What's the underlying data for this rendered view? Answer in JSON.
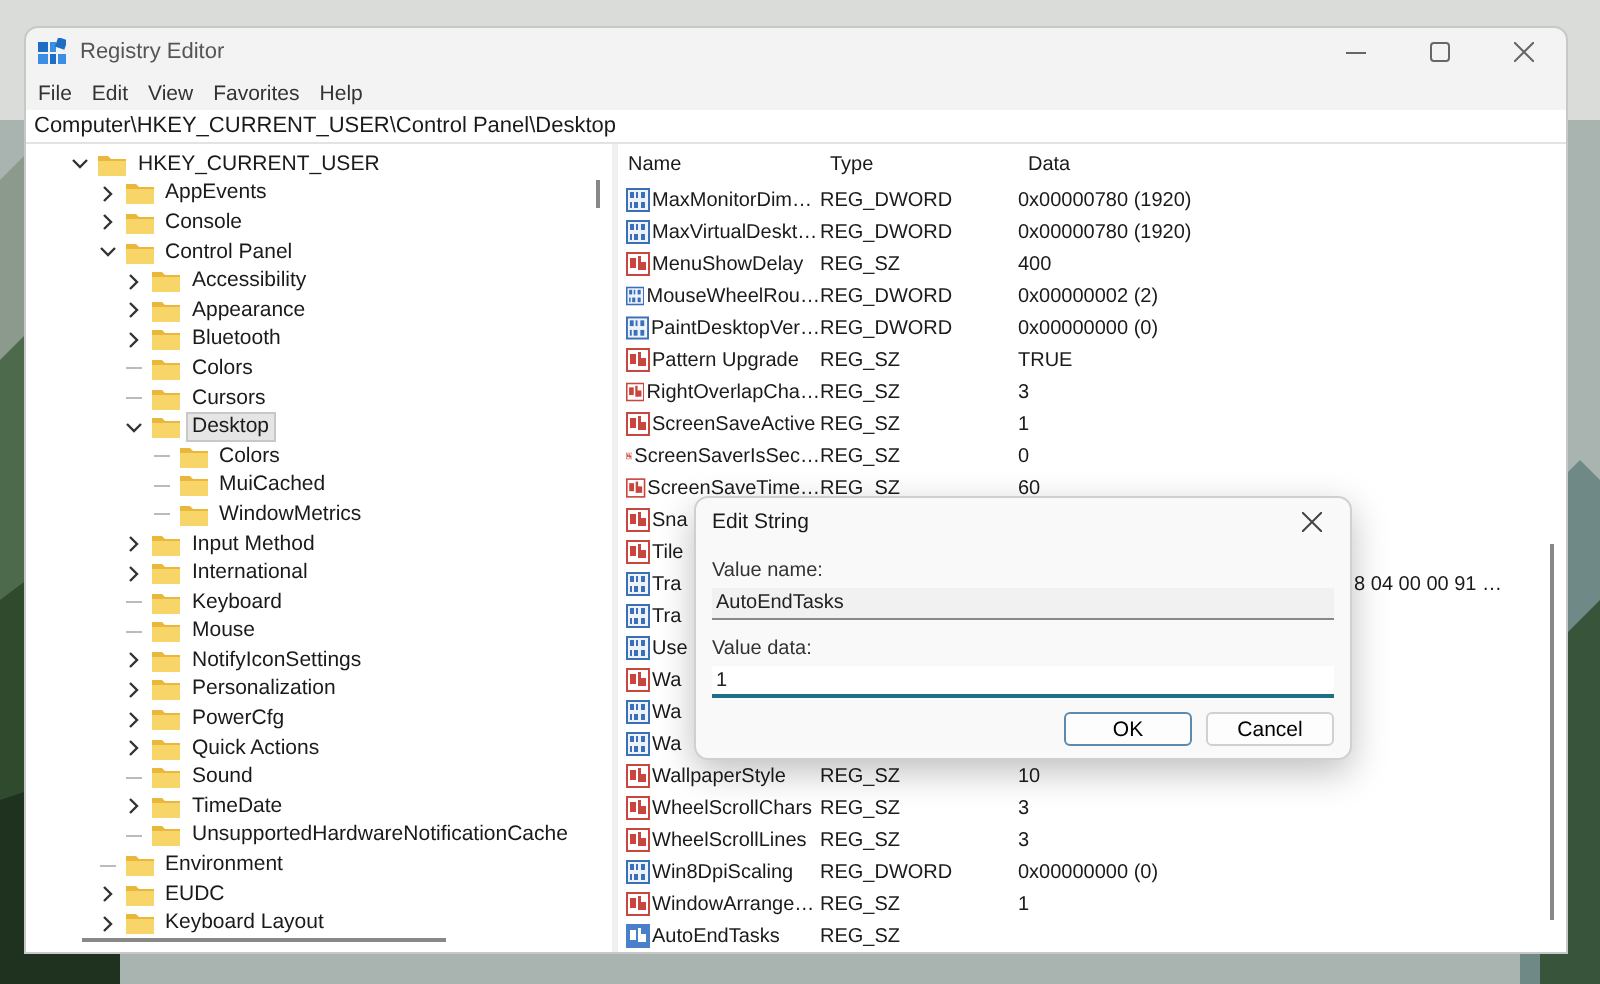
{
  "window": {
    "title": "Registry Editor"
  },
  "menu": [
    "File",
    "Edit",
    "View",
    "Favorites",
    "Help"
  ],
  "address": "Computer\\HKEY_CURRENT_USER\\Control Panel\\Desktop",
  "tree": {
    "items": [
      {
        "label": "HKEY_CURRENT_USER",
        "expanded": true,
        "selected": false,
        "children": [
          {
            "label": "AppEvents",
            "expanded": false,
            "selected": false
          },
          {
            "label": "Console",
            "expanded": false,
            "selected": false
          },
          {
            "label": "Control Panel",
            "expanded": true,
            "selected": false,
            "children": [
              {
                "label": "Accessibility",
                "expanded": false,
                "selected": false
              },
              {
                "label": "Appearance",
                "expanded": false,
                "selected": false
              },
              {
                "label": "Bluetooth",
                "expanded": false,
                "selected": false
              },
              {
                "label": "Colors",
                "selected": false
              },
              {
                "label": "Cursors",
                "selected": false
              },
              {
                "label": "Desktop",
                "expanded": true,
                "selected": true,
                "children": [
                  {
                    "label": "Colors",
                    "selected": false
                  },
                  {
                    "label": "MuiCached",
                    "selected": false
                  },
                  {
                    "label": "WindowMetrics",
                    "selected": false
                  }
                ]
              },
              {
                "label": "Input Method",
                "expanded": false,
                "selected": false
              },
              {
                "label": "International",
                "expanded": false,
                "selected": false
              },
              {
                "label": "Keyboard",
                "selected": false
              },
              {
                "label": "Mouse",
                "selected": false
              },
              {
                "label": "NotifyIconSettings",
                "expanded": false,
                "selected": false
              },
              {
                "label": "Personalization",
                "expanded": false,
                "selected": false
              },
              {
                "label": "PowerCfg",
                "expanded": false,
                "selected": false
              },
              {
                "label": "Quick Actions",
                "expanded": false,
                "selected": false
              },
              {
                "label": "Sound",
                "selected": false
              },
              {
                "label": "TimeDate",
                "expanded": false,
                "selected": false
              },
              {
                "label": "UnsupportedHardwareNotificationCache",
                "selected": false
              }
            ]
          },
          {
            "label": "Environment",
            "selected": false
          },
          {
            "label": "EUDC",
            "expanded": false,
            "selected": false
          },
          {
            "label": "Keyboard Layout",
            "expanded": false,
            "selected": false
          }
        ]
      }
    ]
  },
  "values": {
    "columns": [
      "Name",
      "Type",
      "Data"
    ],
    "rows": [
      {
        "name": "MaxMonitorDim…",
        "type": "REG_DWORD",
        "data": "0x00000780 (1920)",
        "kind": "dword",
        "selected": false
      },
      {
        "name": "MaxVirtualDeskt…",
        "type": "REG_DWORD",
        "data": "0x00000780 (1920)",
        "kind": "dword",
        "selected": false
      },
      {
        "name": "MenuShowDelay",
        "type": "REG_SZ",
        "data": "400",
        "kind": "sz",
        "selected": false
      },
      {
        "name": "MouseWheelRou…",
        "type": "REG_DWORD",
        "data": "0x00000002 (2)",
        "kind": "dword",
        "selected": false
      },
      {
        "name": "PaintDesktopVer…",
        "type": "REG_DWORD",
        "data": "0x00000000 (0)",
        "kind": "dword",
        "selected": false
      },
      {
        "name": "Pattern Upgrade",
        "type": "REG_SZ",
        "data": "TRUE",
        "kind": "sz",
        "selected": false
      },
      {
        "name": "RightOverlapCha…",
        "type": "REG_SZ",
        "data": "3",
        "kind": "sz",
        "selected": false
      },
      {
        "name": "ScreenSaveActive",
        "type": "REG_SZ",
        "data": "1",
        "kind": "sz",
        "selected": false
      },
      {
        "name": "ScreenSaverIsSec…",
        "type": "REG_SZ",
        "data": "0",
        "kind": "sz",
        "selected": false
      },
      {
        "name": "ScreenSaveTime…",
        "type": "REG_SZ",
        "data": "60",
        "kind": "sz",
        "selected": false
      },
      {
        "name": "Sna",
        "kind": "sz",
        "selected": false
      },
      {
        "name": "Tile",
        "kind": "sz",
        "selected": false
      },
      {
        "name": "Tra",
        "data": "8 04 00 00 91 …",
        "kind": "dword",
        "selected": false
      },
      {
        "name": "Tra",
        "kind": "dword",
        "selected": false
      },
      {
        "name": "Use",
        "kind": "dword",
        "selected": false
      },
      {
        "name": "Wa",
        "kind": "sz",
        "selected": false
      },
      {
        "name": "Wa",
        "kind": "dword",
        "selected": false
      },
      {
        "name": "Wa",
        "kind": "dword",
        "selected": false
      },
      {
        "name": "WallpaperStyle",
        "type": "REG_SZ",
        "data": "10",
        "kind": "sz",
        "selected": false
      },
      {
        "name": "WheelScrollChars",
        "type": "REG_SZ",
        "data": "3",
        "kind": "sz",
        "selected": false
      },
      {
        "name": "WheelScrollLines",
        "type": "REG_SZ",
        "data": "3",
        "kind": "sz",
        "selected": false
      },
      {
        "name": "Win8DpiScaling",
        "type": "REG_DWORD",
        "data": "0x00000000 (0)",
        "kind": "dword",
        "selected": false
      },
      {
        "name": "WindowArrange…",
        "type": "REG_SZ",
        "data": "1",
        "kind": "sz",
        "selected": false
      },
      {
        "name": "AutoEndTasks",
        "type": "REG_SZ",
        "kind": "sz",
        "selected": true
      }
    ]
  },
  "dialog": {
    "title": "Edit String",
    "value_name_label": "Value name:",
    "value_name": "AutoEndTasks",
    "value_data_label": "Value data:",
    "value_data": "1",
    "buttons": [
      {
        "label": "OK",
        "default": true
      },
      {
        "label": "Cancel",
        "default": false
      }
    ]
  }
}
